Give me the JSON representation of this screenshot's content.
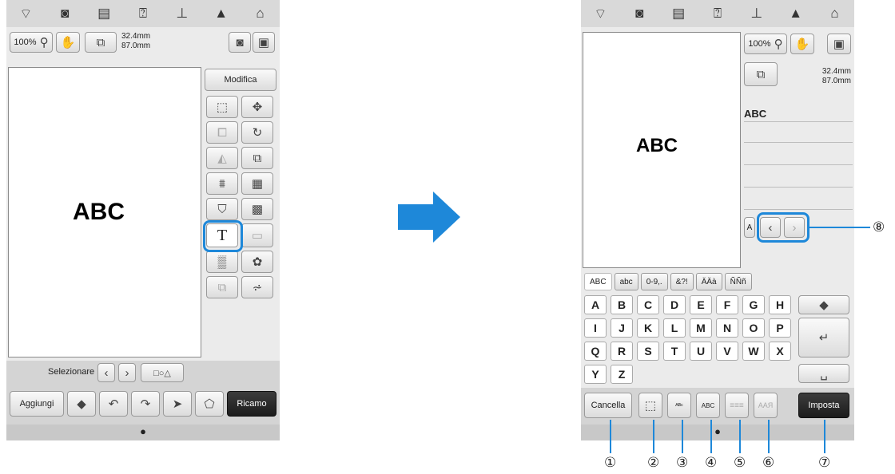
{
  "left_screen": {
    "statusbar_icons": [
      "wifi-icon",
      "camera-icon",
      "document-icon",
      "help-icon",
      "sewing-foot-icon",
      "lock-icon",
      "home-icon"
    ],
    "zoom_label": "100%",
    "size_width": "32.4",
    "size_height": "87.0",
    "size_unit": "mm",
    "preview_text": "ABC",
    "edit_tab_label": "Modifica",
    "text_tool_glyph": "T",
    "select_label": "Selezionare",
    "add_label": "Aggiungi",
    "embroider_label": "Ricamo"
  },
  "right_screen": {
    "statusbar_icons": [
      "wifi-icon",
      "camera-icon",
      "document-icon",
      "help-icon",
      "sewing-foot-icon",
      "lock-icon",
      "home-icon"
    ],
    "zoom_label": "100%",
    "size_width": "32.4",
    "size_height": "87.0",
    "size_unit": "mm",
    "preview_text": "ABC",
    "input_text": "ABC",
    "char_tabs": [
      "ABC",
      "abc",
      "0-9,.",
      "&?!",
      "ÄÄà",
      "ÑÑñ"
    ],
    "key_rows": [
      [
        "A",
        "B",
        "C",
        "D",
        "E",
        "F",
        "G",
        "H"
      ],
      [
        "I",
        "J",
        "K",
        "L",
        "M",
        "N",
        "O",
        "P"
      ],
      [
        "Q",
        "R",
        "S",
        "T",
        "U",
        "V",
        "W",
        "X"
      ],
      [
        "Y",
        "Z"
      ]
    ],
    "cancel_label": "Cancella",
    "set_label": "Imposta",
    "bottom_tools": [
      "text-size-icon",
      "arc-text-icon",
      "straight-text-icon",
      "align-icon",
      "font-style-icon"
    ]
  },
  "callouts": [
    "①",
    "②",
    "③",
    "④",
    "⑤",
    "⑥",
    "⑦",
    "⑧"
  ],
  "accent_color": "#1e88d9"
}
